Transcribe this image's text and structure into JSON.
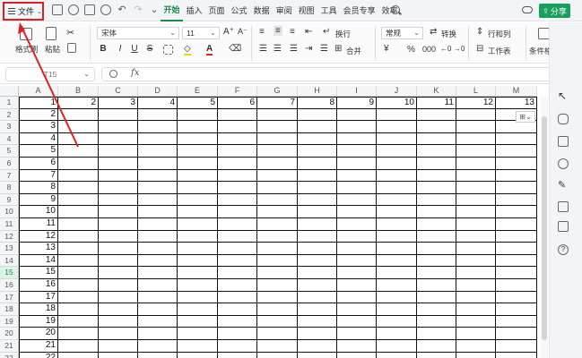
{
  "menubar": {
    "file_label": "文件",
    "tabs": [
      {
        "label": "开始",
        "active": true
      },
      {
        "label": "插入",
        "active": false
      },
      {
        "label": "页面",
        "active": false
      },
      {
        "label": "公式",
        "active": false
      },
      {
        "label": "数据",
        "active": false
      },
      {
        "label": "审阅",
        "active": false
      },
      {
        "label": "视图",
        "active": false
      },
      {
        "label": "工具",
        "active": false
      },
      {
        "label": "会员专享",
        "active": false
      },
      {
        "label": "效率",
        "active": false
      }
    ],
    "share_label": "分享",
    "accent_color": "#1a8a4a"
  },
  "ribbon": {
    "format_painter_label": "格式刷",
    "paste_label": "粘贴",
    "font_name": "宋体",
    "font_size": "11",
    "wrap_label": "换行",
    "merge_label": "合并",
    "number_format": "常规",
    "convert_label": "转换",
    "rows_cols_label": "行和列",
    "worksheet_label": "工作表",
    "conditional_label": "条件格式",
    "bold_glyph": "B",
    "italic_glyph": "I",
    "underline_glyph": "U",
    "strike_glyph": "S",
    "percent_glyph": "%"
  },
  "formula_bar": {
    "name_box": "T15",
    "fx_label": "fx",
    "formula": ""
  },
  "sheet": {
    "columns": [
      "A",
      "B",
      "C",
      "D",
      "E",
      "F",
      "G",
      "H",
      "I",
      "J",
      "K",
      "L",
      "M"
    ],
    "rows": [
      1,
      2,
      3,
      4,
      5,
      6,
      7,
      8,
      9,
      10,
      11,
      12,
      13,
      14,
      15,
      16,
      17,
      18,
      19,
      20,
      21,
      22
    ],
    "active_row": 15,
    "row1_values": [
      "1",
      "2",
      "3",
      "4",
      "5",
      "6",
      "7",
      "8",
      "9",
      "10",
      "11",
      "12",
      "13"
    ],
    "colA_values": [
      "1",
      "2",
      "3",
      "4",
      "5",
      "6",
      "7",
      "8",
      "9",
      "10",
      "11",
      "12",
      "13",
      "14",
      "15",
      "16",
      "17",
      "18",
      "19",
      "20",
      "21",
      "22"
    ]
  },
  "annotation": {
    "box_color": "#e02020"
  }
}
